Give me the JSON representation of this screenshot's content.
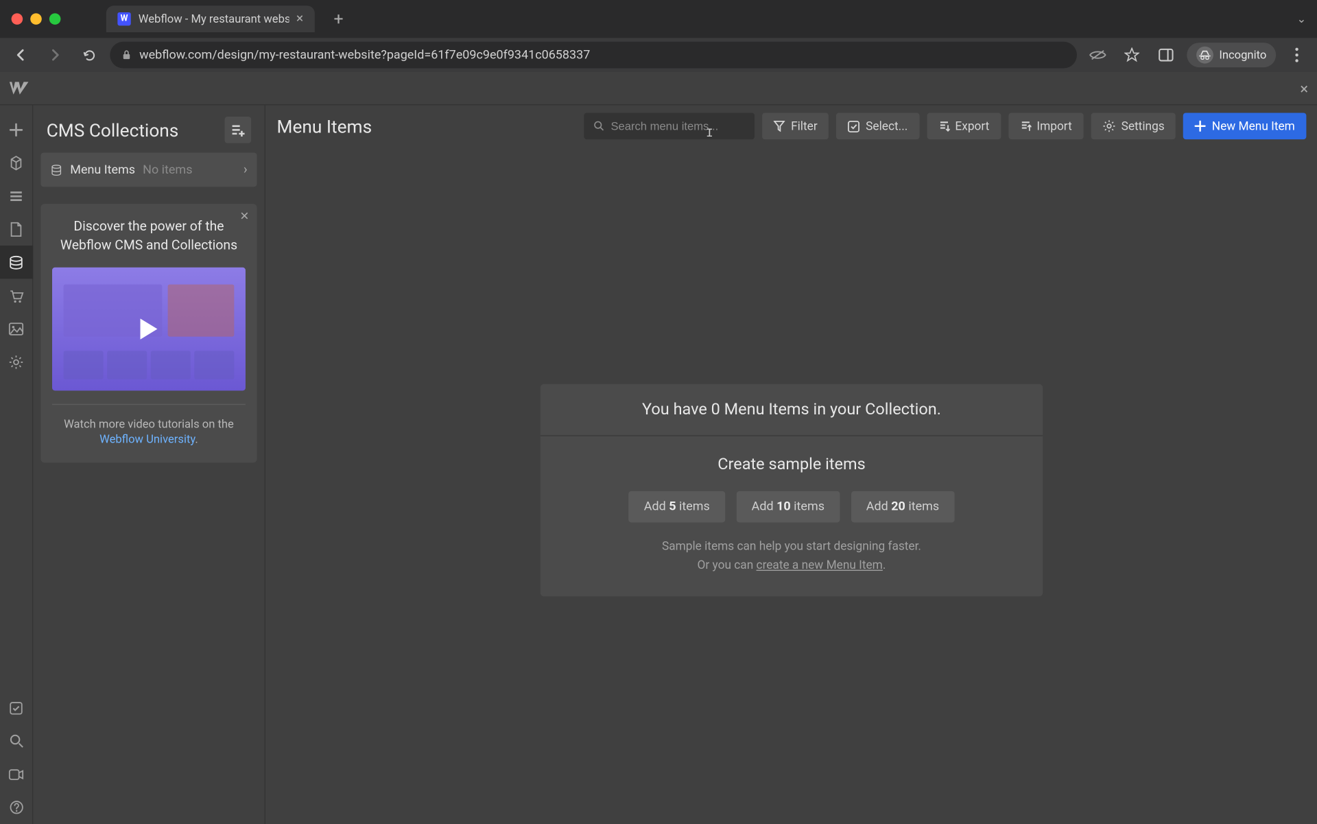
{
  "browser": {
    "tab_title": "Webflow - My restaurant webs",
    "url": "webflow.com/design/my-restaurant-website?pageId=61f7e09c9e0f9341c0658337",
    "incognito_label": "Incognito"
  },
  "sidebar": {
    "title": "CMS Collections",
    "collections": [
      {
        "name": "Menu Items",
        "count_label": "No items"
      }
    ],
    "promo": {
      "title": "Discover the power of the Webflow CMS and Collections",
      "subtext": "Watch more video tutorials on the ",
      "link_text": "Webflow University",
      "subtext_suffix": "."
    }
  },
  "main": {
    "title": "Menu Items",
    "search_placeholder": "Search menu items...",
    "buttons": {
      "filter": "Filter",
      "select": "Select...",
      "export": "Export",
      "import": "Import",
      "settings": "Settings",
      "new_item": "New Menu Item"
    },
    "empty": {
      "heading": "You have 0 Menu Items in your Collection.",
      "subtitle": "Create sample items",
      "samples": [
        {
          "prefix": "Add ",
          "count": "5",
          "suffix": " items"
        },
        {
          "prefix": "Add ",
          "count": "10",
          "suffix": " items"
        },
        {
          "prefix": "Add ",
          "count": "20",
          "suffix": " items"
        }
      ],
      "hint1": "Sample items can help you start designing faster.",
      "hint2_pre": "Or you can ",
      "hint2_link": "create a new Menu Item",
      "hint2_post": "."
    }
  }
}
